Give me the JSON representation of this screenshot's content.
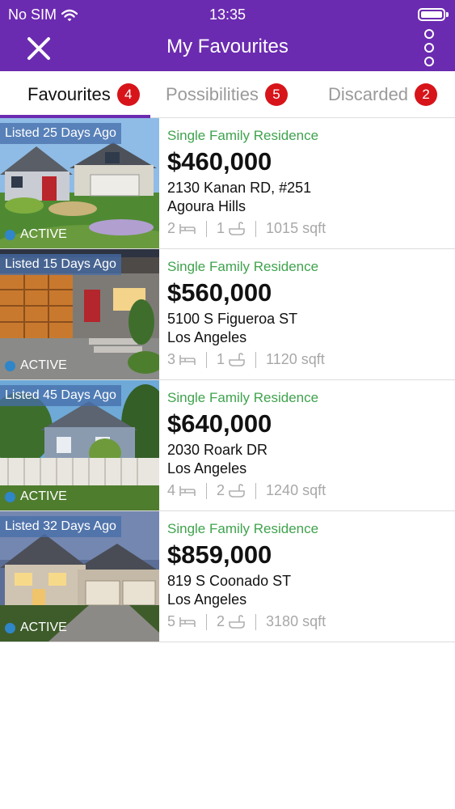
{
  "status_bar": {
    "carrier": "No SIM",
    "time": "13:35"
  },
  "header": {
    "title": "My Favourites",
    "close_icon": "close-icon",
    "menu_icon": "more-vertical-icon"
  },
  "tabs": [
    {
      "label": "Favourites",
      "badge": "4",
      "active": true
    },
    {
      "label": "Possibilities",
      "badge": "5",
      "active": false
    },
    {
      "label": "Discarded",
      "badge": "2",
      "active": false
    }
  ],
  "colors": {
    "brand": "#6b2bb0",
    "badge": "#d7141a",
    "type_text": "#3fa34d",
    "status_dot": "#2f86c8"
  },
  "listings": [
    {
      "listed": "Listed 25 Days Ago",
      "status": "ACTIVE",
      "type": "Single Family Residence",
      "price": "$460,000",
      "address": "2130 Kanan RD, #251",
      "city": "Agoura Hills",
      "beds": "2",
      "baths": "1",
      "sqft": "1015 sqft"
    },
    {
      "listed": "Listed 15 Days Ago",
      "status": "ACTIVE",
      "type": "Single Family Residence",
      "price": "$560,000",
      "address": "5100 S Figueroa ST",
      "city": "Los Angeles",
      "beds": "3",
      "baths": "1",
      "sqft": "1120 sqft"
    },
    {
      "listed": "Listed 45 Days Ago",
      "status": "ACTIVE",
      "type": "Single Family Residence",
      "price": "$640,000",
      "address": "2030 Roark DR",
      "city": "Los Angeles",
      "beds": "4",
      "baths": "2",
      "sqft": "1240 sqft"
    },
    {
      "listed": "Listed 32 Days Ago",
      "status": "ACTIVE",
      "type": "Single Family Residence",
      "price": "$859,000",
      "address": "819 S Coonado ST",
      "city": "Los Angeles",
      "beds": "5",
      "baths": "2",
      "sqft": "3180 sqft"
    }
  ]
}
